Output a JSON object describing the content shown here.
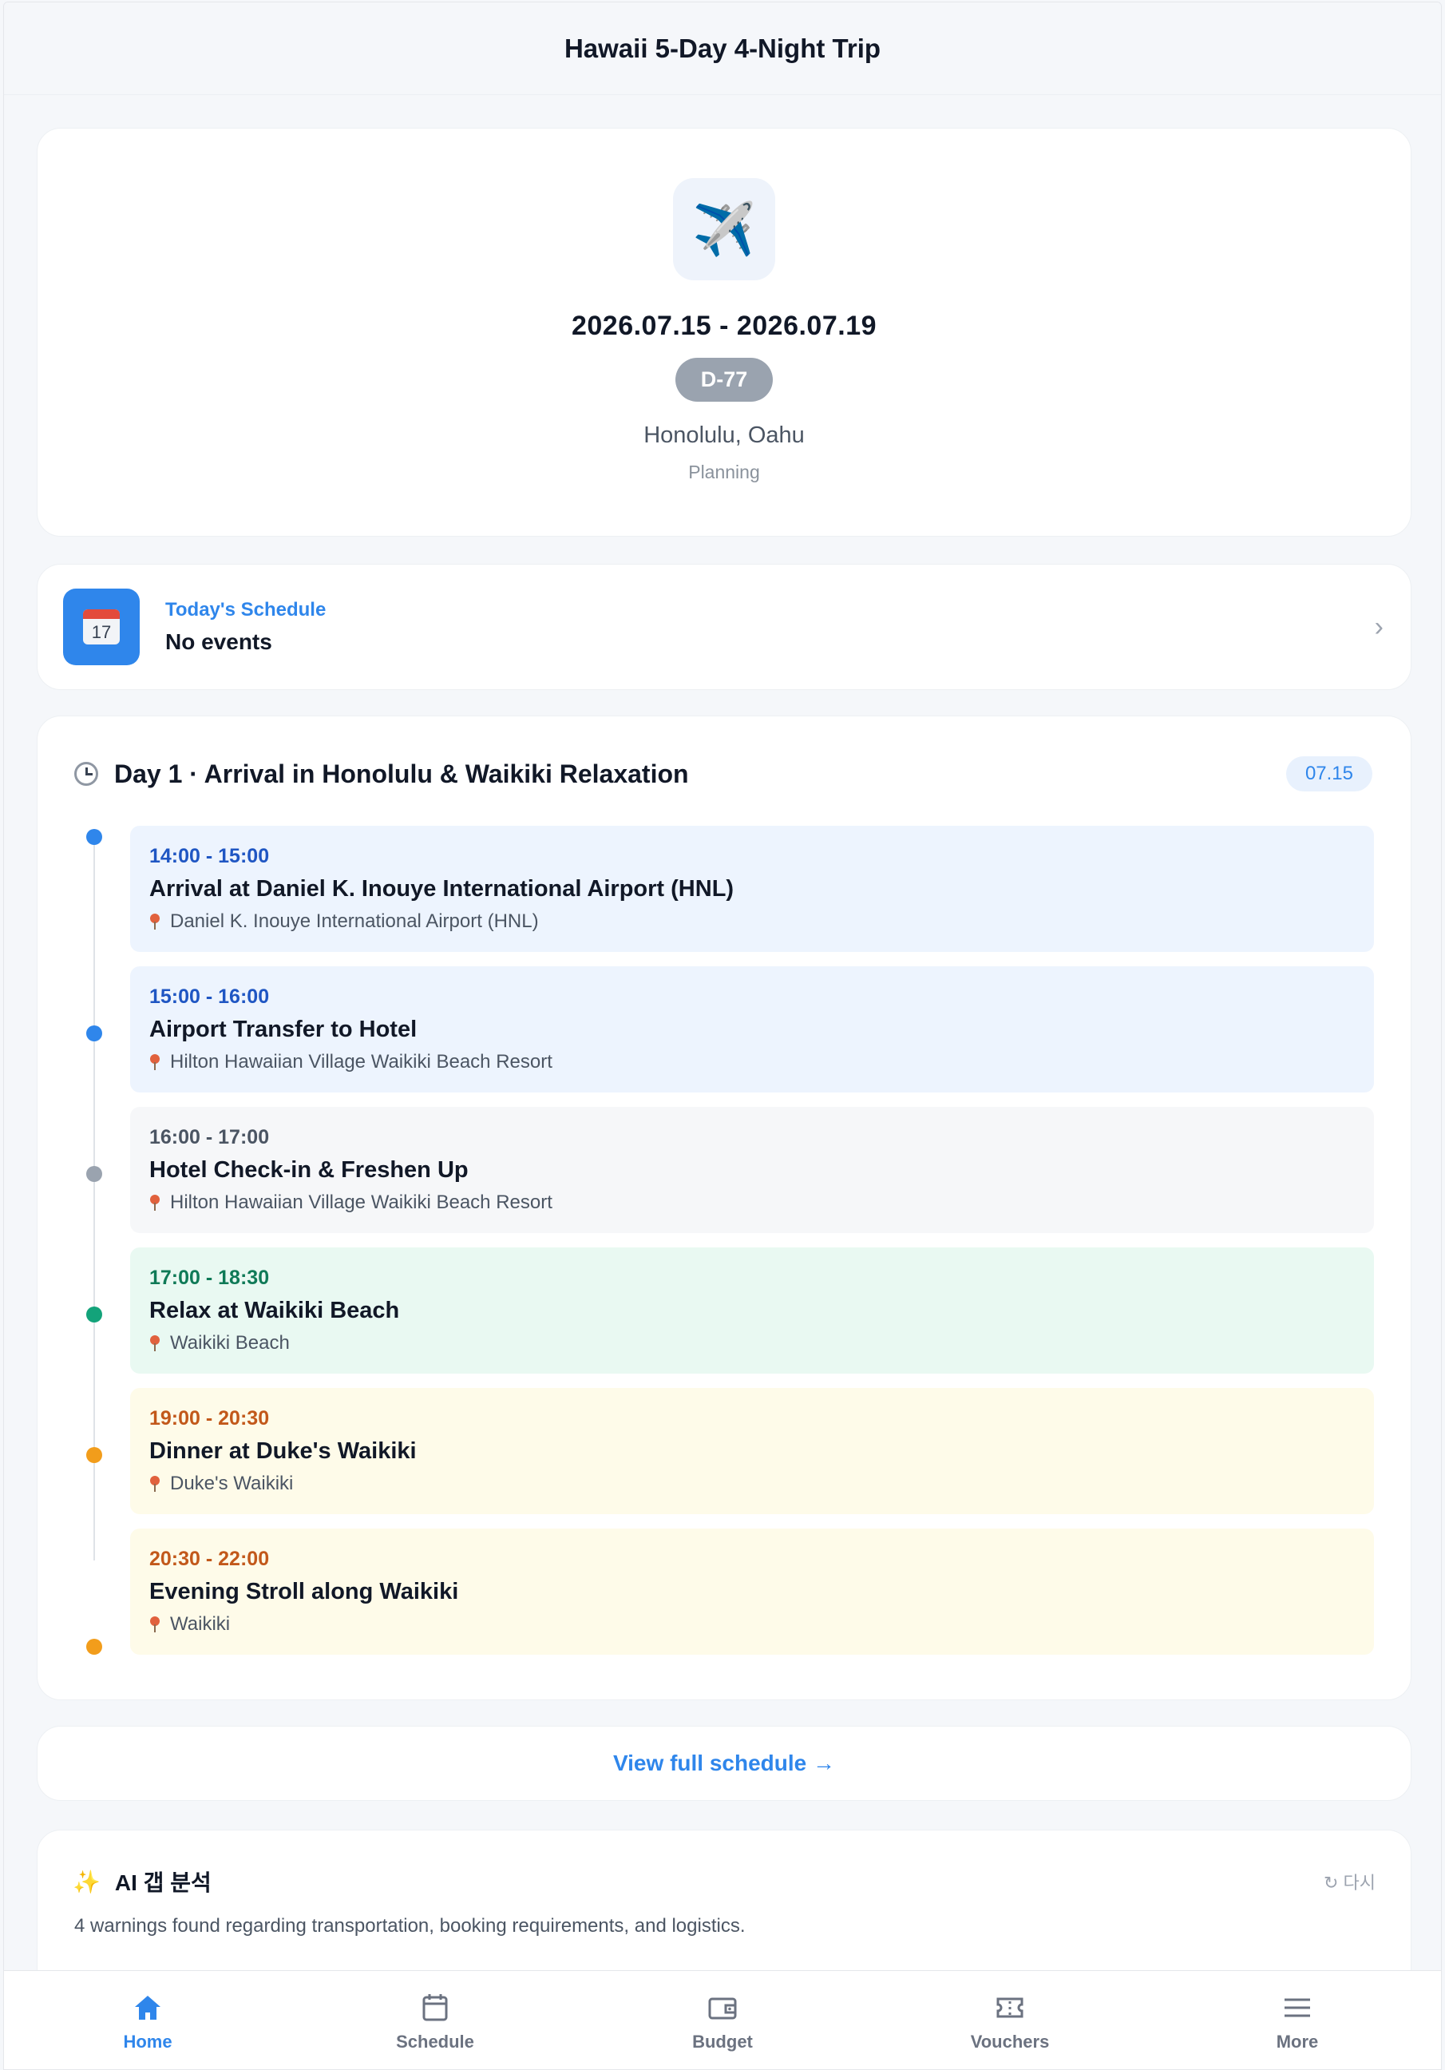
{
  "header": {
    "title": "Hawaii 5-Day 4-Night Trip"
  },
  "trip": {
    "icon": "airplane-icon",
    "dates": "2026.07.15 - 2026.07.19",
    "dday": "D-77",
    "location": "Honolulu, Oahu",
    "status": "Planning"
  },
  "today": {
    "icon": "calendar-icon",
    "label": "Today's Schedule",
    "value": "No events",
    "chevron": "›"
  },
  "day": {
    "title": "Day 1 · Arrival in Honolulu & Waikiki Relaxation",
    "date": "07.15",
    "events": [
      {
        "time": "14:00 - 15:00",
        "title": "Arrival at Daniel K. Inouye International Airport (HNL)",
        "place": "Daniel K. Inouye International Airport (HNL)",
        "color": "#2f86eb"
      },
      {
        "time": "15:00 - 16:00",
        "title": "Airport Transfer to Hotel",
        "place": "Hilton Hawaiian Village Waikiki Beach Resort",
        "color": "#2f86eb"
      },
      {
        "time": "16:00 - 17:00",
        "title": "Hotel Check-in & Freshen Up",
        "place": "Hilton Hawaiian Village Waikiki Beach Resort",
        "color": "#9aa3af"
      },
      {
        "time": "17:00 - 18:30",
        "title": "Relax at Waikiki Beach",
        "place": "Waikiki Beach",
        "color": "#13a37a"
      },
      {
        "time": "19:00 - 20:30",
        "title": "Dinner at Duke's Waikiki",
        "place": "Duke's Waikiki",
        "color": "#f29d1b"
      },
      {
        "time": "20:30 - 22:00",
        "title": "Evening Stroll along Waikiki",
        "place": "Waikiki",
        "color": "#f29d1b"
      }
    ]
  },
  "view_full": {
    "label": "View full schedule →"
  },
  "ai": {
    "title": "AI 갭 분석",
    "retry": "↻ 다시",
    "summary": "4 warnings found regarding transportation, booking requirements, and logistics."
  },
  "nav": {
    "items": [
      {
        "label": "Home",
        "icon": "home-icon",
        "active": true
      },
      {
        "label": "Schedule",
        "icon": "calendar-icon",
        "active": false
      },
      {
        "label": "Budget",
        "icon": "wallet-icon",
        "active": false
      },
      {
        "label": "Vouchers",
        "icon": "ticket-icon",
        "active": false
      },
      {
        "label": "More",
        "icon": "menu-icon",
        "active": false
      }
    ]
  },
  "colors": {
    "accent": "#2f86eb",
    "dday": "#9aa3af"
  }
}
